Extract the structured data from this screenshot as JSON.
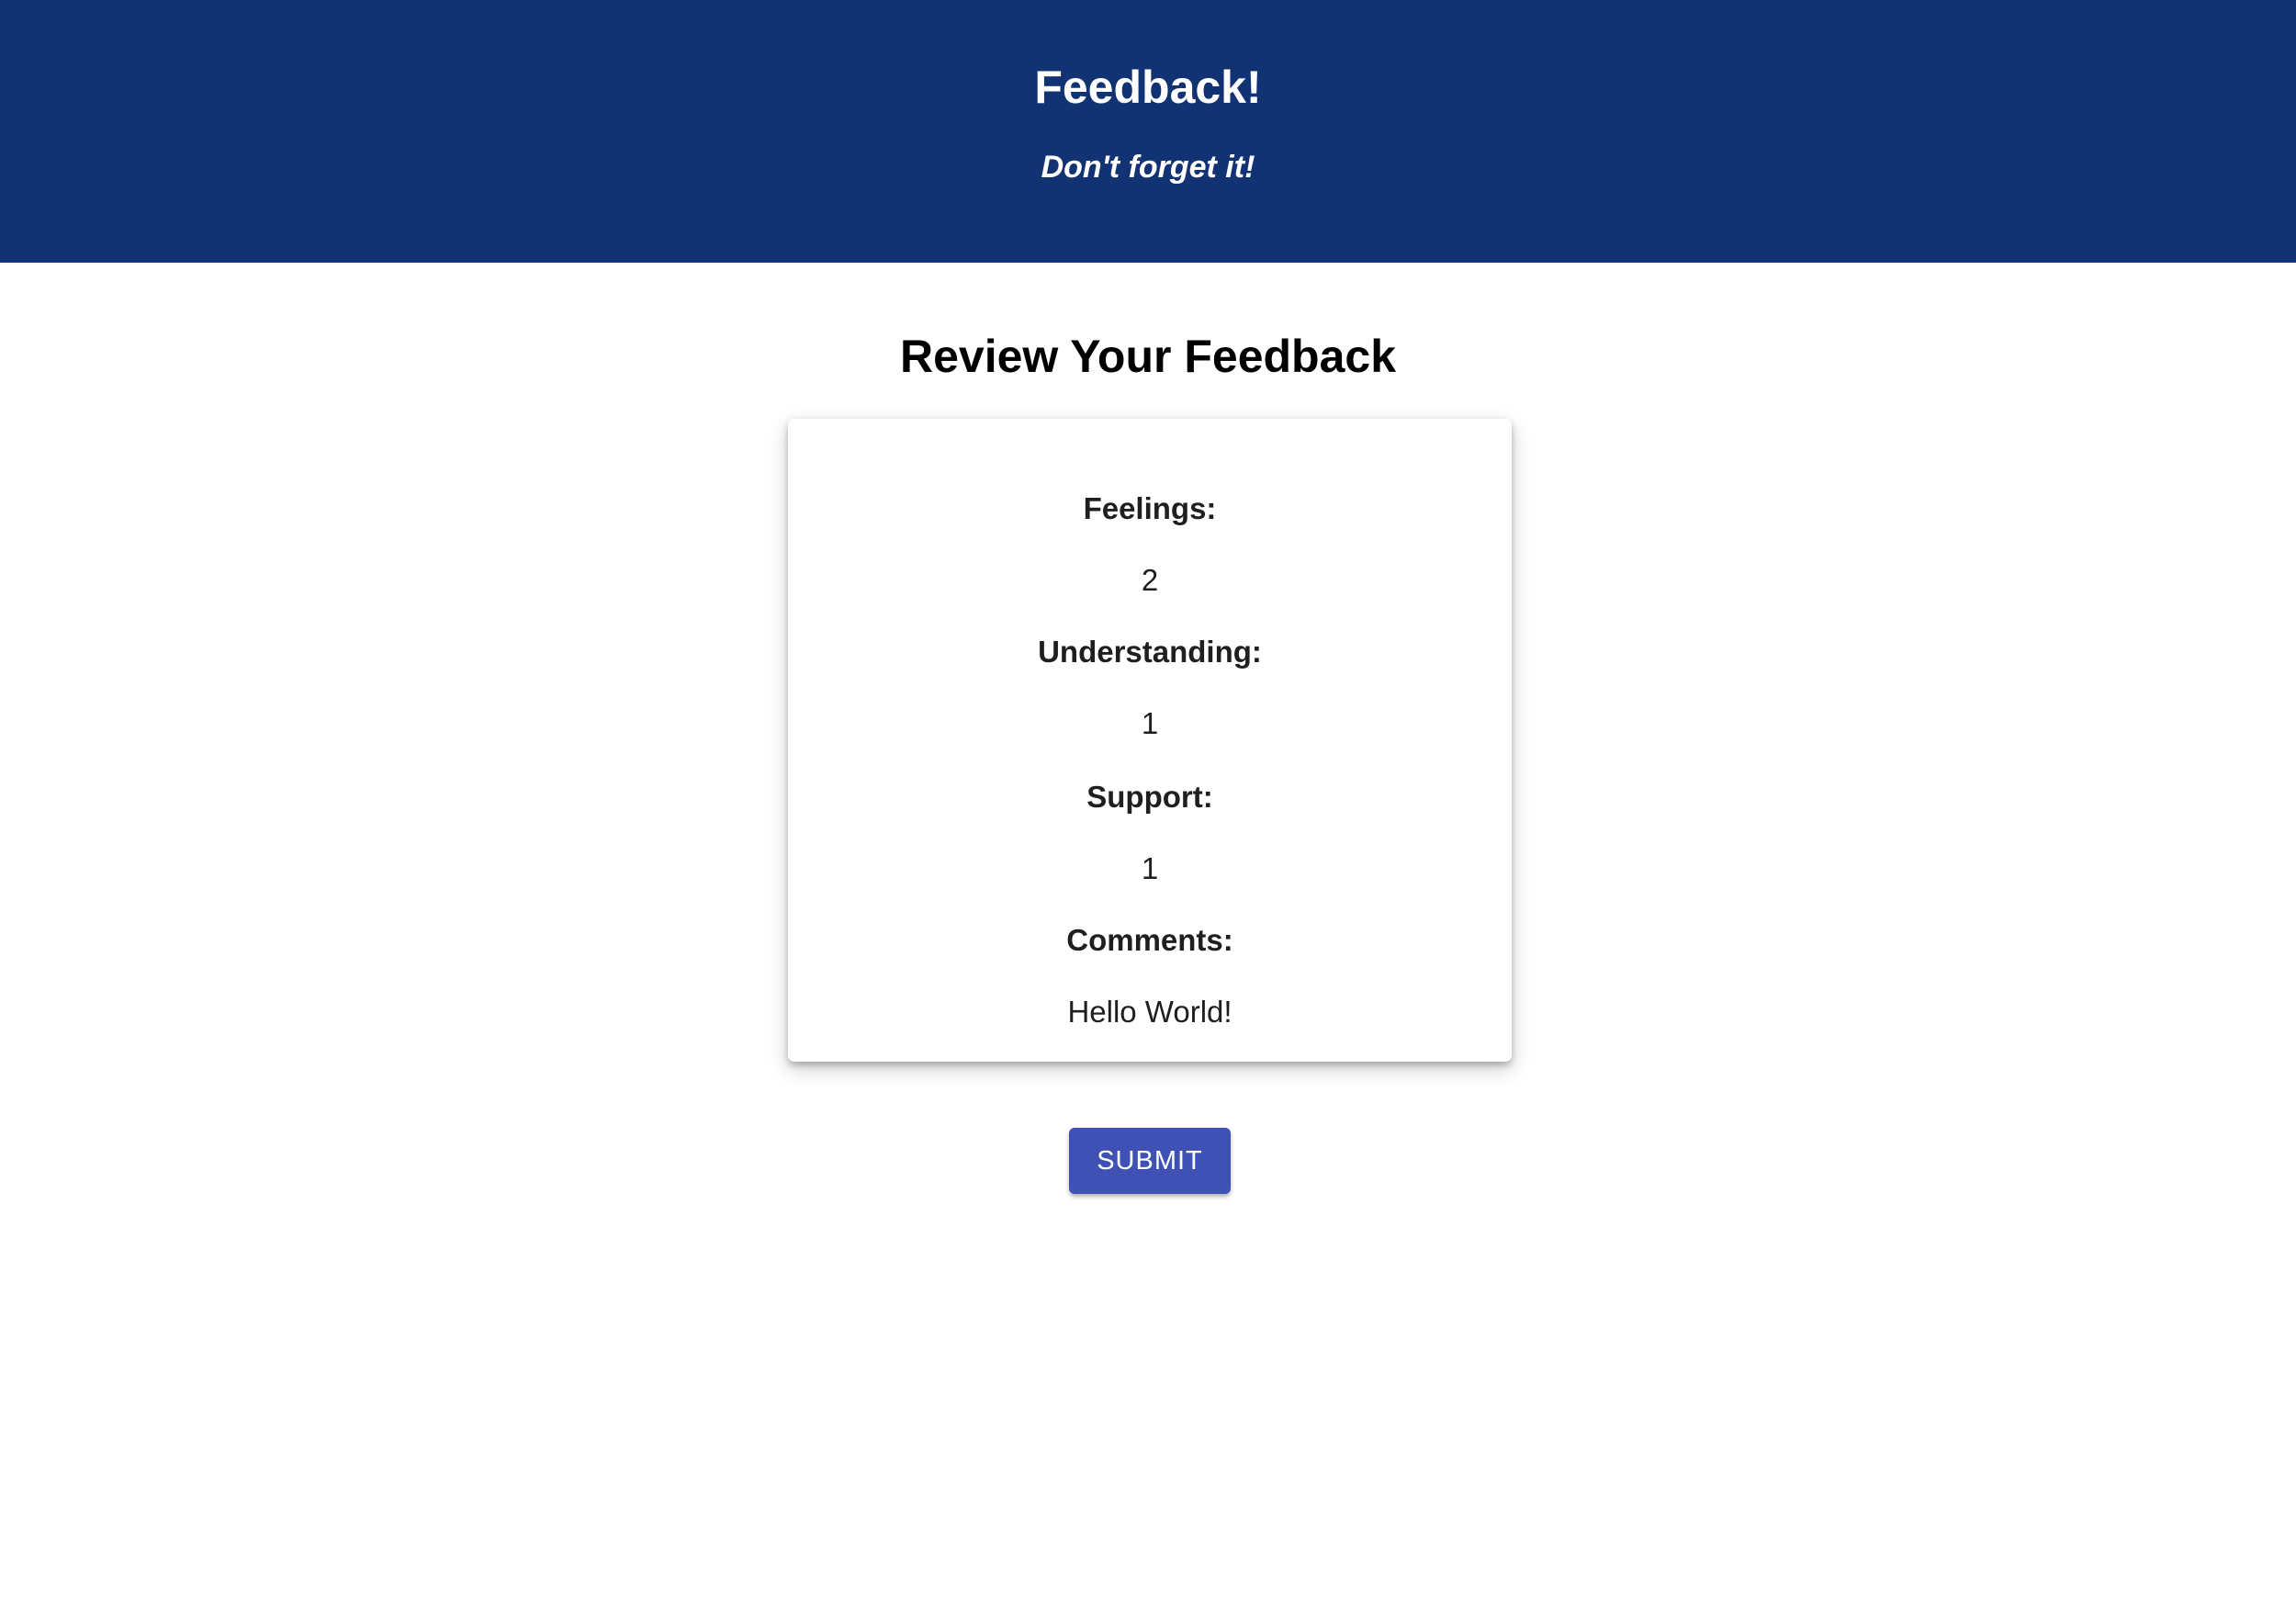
{
  "header": {
    "title": "Feedback!",
    "subtitle": "Don't forget it!"
  },
  "main": {
    "heading": "Review Your Feedback",
    "review": {
      "feelings_label": "Feelings:",
      "feelings_value": "2",
      "understanding_label": "Understanding:",
      "understanding_value": "1",
      "support_label": "Support:",
      "support_value": "1",
      "comments_label": "Comments:",
      "comments_value": "Hello World!"
    },
    "submit_label": "SUBMIT"
  },
  "colors": {
    "header_background": "#113374",
    "button_background": "#3f51b5"
  }
}
